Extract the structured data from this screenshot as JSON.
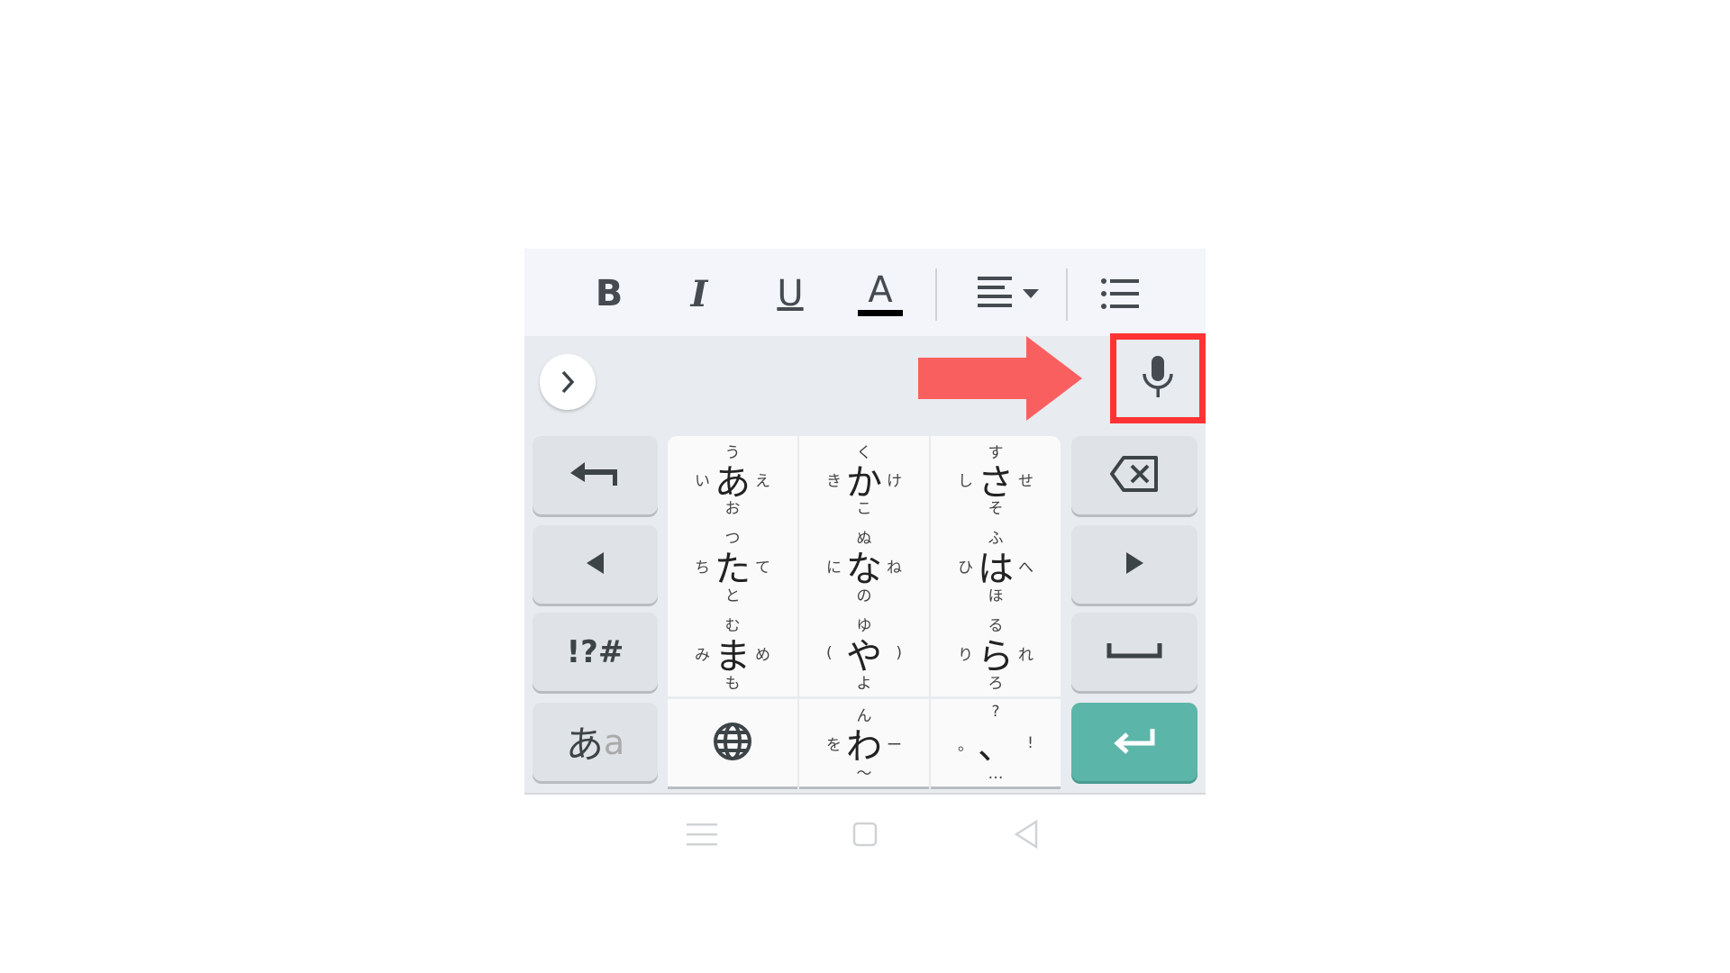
{
  "toolbar": {
    "bold": "B",
    "italic": "I",
    "underline": "U",
    "text_color": "A",
    "align_icon": "align-left-icon",
    "list_icon": "bulleted-list-icon",
    "text_color_value": "#000000"
  },
  "suggestion_bar": {
    "expand_icon": "chevron-right-icon",
    "mic_icon": "microphone-icon",
    "highlight_color": "#ff3333",
    "arrow_color": "#fa5f5f"
  },
  "keys": {
    "left": [
      {
        "icon": "undo-arrow-icon"
      },
      {
        "icon": "cursor-left-icon"
      },
      {
        "label": "!?#"
      },
      {
        "label": "あ",
        "sub": "a"
      }
    ],
    "right": [
      {
        "icon": "backspace-icon"
      },
      {
        "icon": "cursor-right-icon"
      },
      {
        "icon": "space-icon"
      },
      {
        "icon": "enter-icon",
        "color": "#5bb5a8"
      }
    ],
    "center": [
      {
        "m": "あ",
        "t": "う",
        "b": "お",
        "l": "い",
        "r": "え"
      },
      {
        "m": "か",
        "t": "く",
        "b": "こ",
        "l": "き",
        "r": "け"
      },
      {
        "m": "さ",
        "t": "す",
        "b": "そ",
        "l": "し",
        "r": "せ"
      },
      {
        "m": "た",
        "t": "つ",
        "b": "と",
        "l": "ち",
        "r": "て"
      },
      {
        "m": "な",
        "t": "ぬ",
        "b": "の",
        "l": "に",
        "r": "ね"
      },
      {
        "m": "は",
        "t": "ふ",
        "b": "ほ",
        "l": "ひ",
        "r": "へ"
      },
      {
        "m": "ま",
        "t": "む",
        "b": "も",
        "l": "み",
        "r": "め"
      },
      {
        "m": "や",
        "t": "ゆ",
        "b": "よ",
        "l": "(",
        "r": ")"
      },
      {
        "m": "ら",
        "t": "る",
        "b": "ろ",
        "l": "り",
        "r": "れ"
      },
      {
        "icon": "globe-icon"
      },
      {
        "m": "わ",
        "t": "ん",
        "b": "〜",
        "l": "を",
        "r": "ー"
      },
      {
        "m": "、",
        "t": "?",
        "b": "…",
        "l": "。",
        "r": "!"
      }
    ]
  },
  "navbar": {
    "menu_icon": "menu-icon",
    "home_icon": "home-square-icon",
    "back_icon": "back-triangle-icon"
  }
}
